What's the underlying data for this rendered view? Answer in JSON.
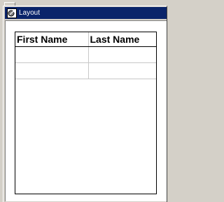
{
  "window": {
    "title": "Layout"
  },
  "table": {
    "columns": [
      "First Name",
      "Last Name"
    ],
    "rows": [
      [
        "",
        ""
      ],
      [
        "",
        ""
      ]
    ]
  },
  "colors": {
    "titlebar": "#0a246a",
    "chrome": "#d4d0c8",
    "grid_line": "#c8c8c8"
  },
  "icons": {
    "window_icon": "app-window-icon"
  }
}
